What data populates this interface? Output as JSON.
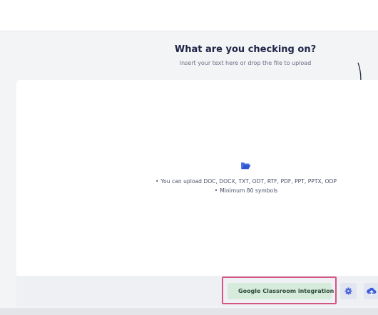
{
  "header": {
    "title": "What are you checking on?",
    "subtitle": "Insert your text here or drop the file to upload"
  },
  "panel": {
    "upload_icon": "folder-open-icon",
    "hints": [
      "You can upload DOC, DOCX, TXT, ODT, RTF, PDF, PPT, PPTX, ODP",
      "Minimum 80 symbols"
    ]
  },
  "footer": {
    "google_classroom_label": "Google Classroom integration",
    "settings_icon": "gear-icon",
    "upload_icon": "cloud-upload-icon"
  },
  "colors": {
    "accent": "#3b5bdb",
    "highlight_border": "#d45582",
    "classroom_button_bg": "#d6ebdc",
    "classroom_icon": "#1e8e3e"
  }
}
